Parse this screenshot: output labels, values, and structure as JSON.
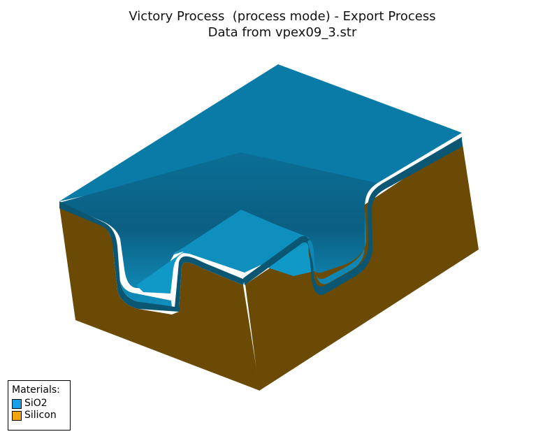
{
  "header": {
    "title_line1": "Victory Process  (process mode) - Export Process",
    "title_line2": "Data from vpex09_3.str"
  },
  "legend": {
    "heading": "Materials:",
    "items": [
      {
        "label": "SiO2",
        "color": "#17a2e8"
      },
      {
        "label": "Silicon",
        "color": "#f2a510"
      }
    ]
  },
  "colors": {
    "oxide_top": "#0a7ba6",
    "oxide_dark": "#0b5672",
    "oxide_wall": "#0f89b5",
    "oxide_floor": "#1098c7",
    "silicon_side": "#6a4a05"
  }
}
